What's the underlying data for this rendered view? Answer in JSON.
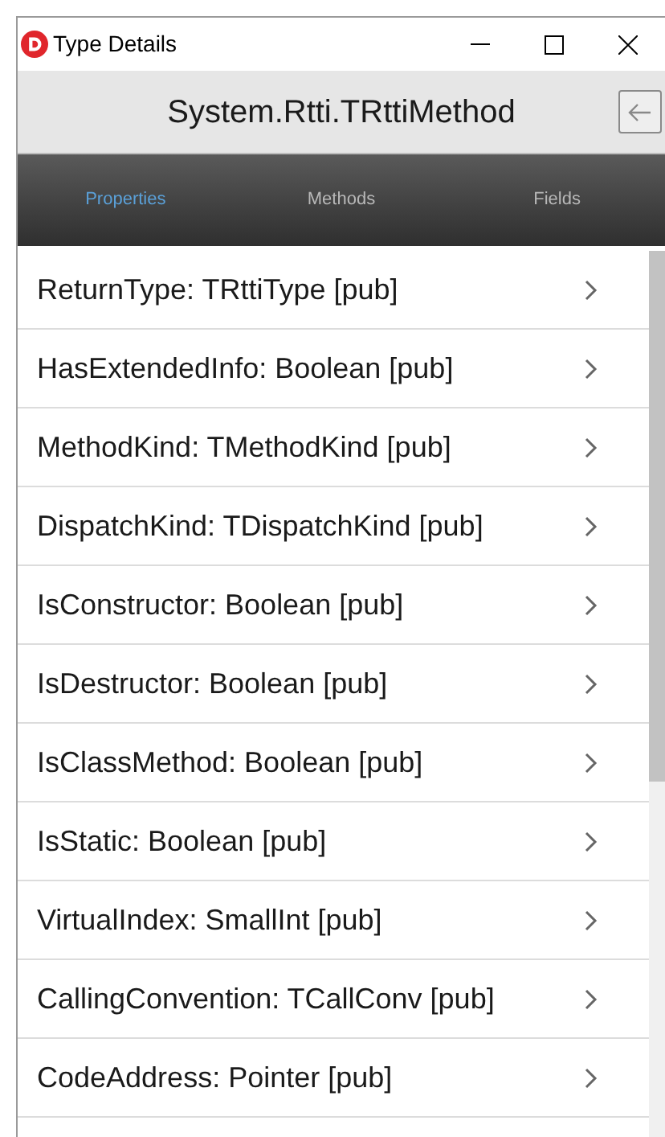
{
  "window": {
    "title": "Type Details"
  },
  "header": {
    "title": "System.Rtti.TRttiMethod"
  },
  "tabs": [
    {
      "label": "Properties",
      "selected": true
    },
    {
      "label": "Methods",
      "selected": false
    },
    {
      "label": "Fields",
      "selected": false
    }
  ],
  "items": [
    "ReturnType: TRttiType [pub]",
    "HasExtendedInfo: Boolean [pub]",
    "MethodKind: TMethodKind [pub]",
    "DispatchKind: TDispatchKind [pub]",
    "IsConstructor: Boolean [pub]",
    "IsDestructor: Boolean [pub]",
    "IsClassMethod: Boolean [pub]",
    "IsStatic: Boolean [pub]",
    "VirtualIndex: SmallInt [pub]",
    "CallingConvention: TCallConv [pub]",
    "CodeAddress: Pointer [pub]"
  ]
}
